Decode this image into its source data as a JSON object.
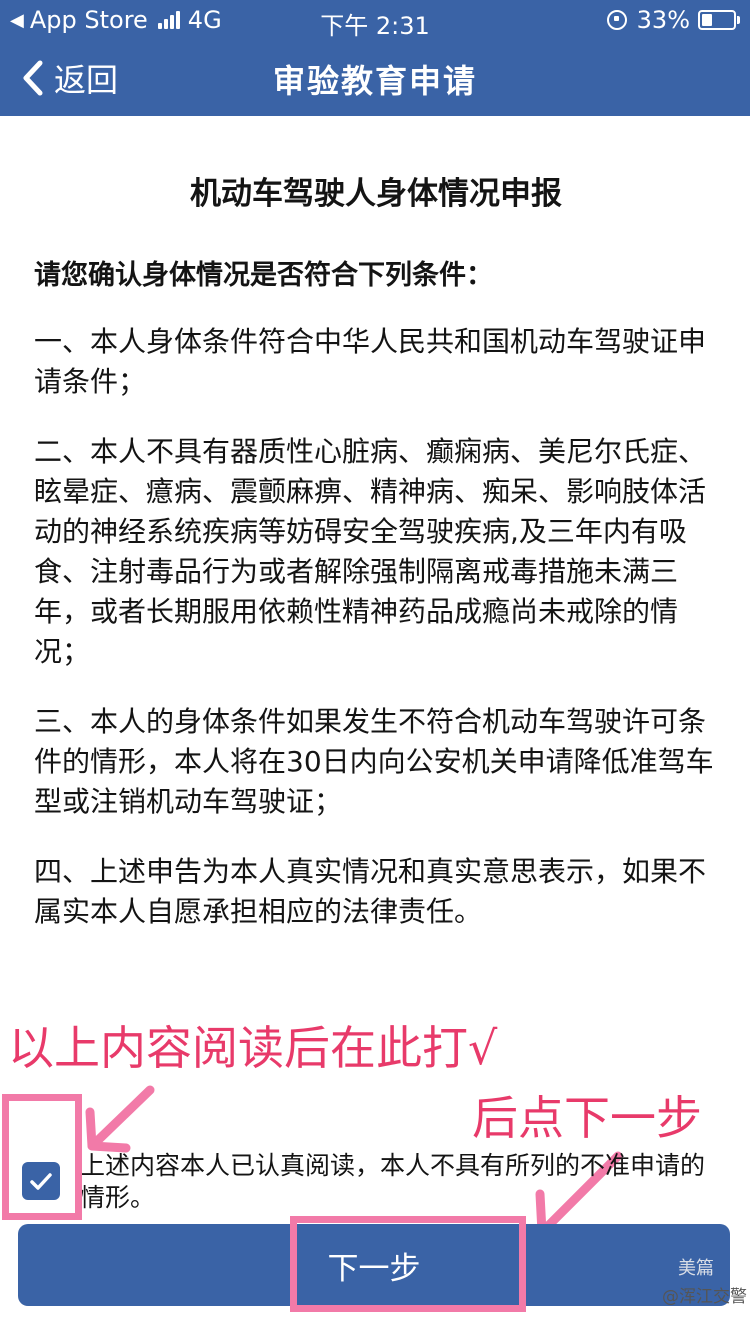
{
  "status_bar": {
    "back_app": "App Store",
    "network": "4G",
    "time": "下午 2:31",
    "battery": "33%",
    "battery_level": 0.33
  },
  "nav": {
    "back_label": "返回",
    "title": "审验教育申请"
  },
  "document": {
    "title": "机动车驾驶人身体情况申报",
    "intro": "请您确认身体情况是否符合下列条件：",
    "clauses": [
      "一、本人身体条件符合中华人民共和国机动车驾驶证申请条件；",
      "二、本人不具有器质性心脏病、癫痫病、美尼尔氏症、眩晕症、癔病、震颤麻痹、精神病、痴呆、影响肢体活动的神经系统疾病等妨碍安全驾驶疾病,及三年内有吸食、注射毒品行为或者解除强制隔离戒毒措施未满三年，或者长期服用依赖性精神药品成瘾尚未戒除的情况；",
      "三、本人的身体条件如果发生不符合机动车驾驶许可条件的情形，本人将在30日内向公安机关申请降低准驾车型或注销机动车驾驶证；",
      "四、上述申告为本人真实情况和真实意思表示，如果不属实本人自愿承担相应的法律责任。"
    ]
  },
  "annotations": {
    "check_hint": "以上内容阅读后在此打√",
    "next_hint": "后点下一步"
  },
  "agreement": {
    "checked": true,
    "text": "上述内容本人已认真阅读，本人不具有所列的不准申请的情形。"
  },
  "next_button": {
    "label": "下一步"
  },
  "watermark": {
    "brand": "美篇",
    "account": "@浑江交警"
  },
  "colors": {
    "primary": "#3a63a6",
    "annotation": "#e83a6a",
    "highlight_box": "#f27aa8"
  }
}
